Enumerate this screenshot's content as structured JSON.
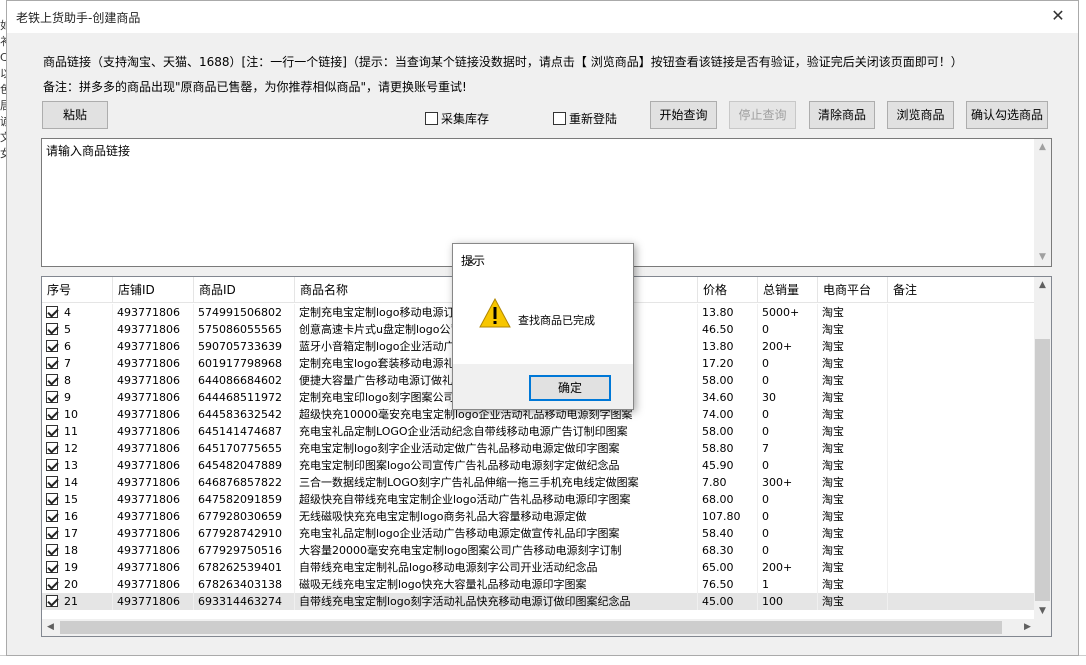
{
  "background_app": {
    "left_chars": [
      "如",
      "衤",
      "Ct",
      "以",
      "色",
      "居",
      "谚",
      "文",
      "女"
    ]
  },
  "window": {
    "title": "老铁上货助手-创建商品",
    "close_glyph": "✕"
  },
  "notes": {
    "line1": "商品链接（支持淘宝、天猫、1688）[注：一行一个链接]（提示：当查询某个链接没数据时，请点击【 浏览商品】按钮查看该链接是否有验证，验证完后关闭该页面即可！）",
    "line2": "备注：拼多多的商品出现\"原商品已售罄，为你推荐相似商品\"，请更换账号重试!"
  },
  "toolbar": {
    "paste": "粘贴",
    "collect_stock": "采集库存",
    "relogin": "重新登陆",
    "start_query": "开始查询",
    "stop_query": "停止查询",
    "clear": "清除商品",
    "browse": "浏览商品",
    "confirm": "确认勾选商品"
  },
  "link_input": {
    "placeholder": "请输入商品链接"
  },
  "table": {
    "columns": [
      "序号",
      "店铺ID",
      "商品ID",
      "商品名称",
      "价格",
      "总销量",
      "电商平台",
      "备注"
    ],
    "rows": [
      {
        "no": "4",
        "shop": "493771806",
        "id": "574991506802",
        "name": "定制充电宝定制logo移动电源订做广告礼品充电宝刻字定制印字图案",
        "price": "13.80",
        "sales": "5000+",
        "platform": "淘宝",
        "note": ""
      },
      {
        "no": "5",
        "shop": "493771806",
        "id": "575086055565",
        "name": "创意高速卡片式u盘定制logo公司礼品刻字订做广告U盘定制图案",
        "price": "46.50",
        "sales": "0",
        "platform": "淘宝",
        "note": ""
      },
      {
        "no": "6",
        "shop": "493771806",
        "id": "590705733639",
        "name": "蓝牙小音箱定制logo企业活动广告礼品刻字定制图案",
        "price": "13.80",
        "sales": "200+",
        "platform": "淘宝",
        "note": ""
      },
      {
        "no": "7",
        "shop": "493771806",
        "id": "601917798968",
        "name": "定制充电宝logo套装移动电源礼品定制印刷logo",
        "price": "17.20",
        "sales": "0",
        "platform": "淘宝",
        "note": ""
      },
      {
        "no": "8",
        "shop": "493771806",
        "id": "644086684602",
        "name": "便捷大容量广告移动电源订做礼品充电宝定做",
        "price": "58.00",
        "sales": "0",
        "platform": "淘宝",
        "note": ""
      },
      {
        "no": "9",
        "shop": "493771806",
        "id": "644468511972",
        "name": "定制充电宝印logo刻字图案公司礼品定制印户",
        "price": "34.60",
        "sales": "30",
        "platform": "淘宝",
        "note": ""
      },
      {
        "no": "10",
        "shop": "493771806",
        "id": "644583632542",
        "name": "超级快充10000毫安充电宝定制logo企业活动礼品移动电源刻字图案",
        "price": "74.00",
        "sales": "0",
        "platform": "淘宝",
        "note": ""
      },
      {
        "no": "11",
        "shop": "493771806",
        "id": "645141474687",
        "name": "充电宝礼品定制LOGO企业活动纪念自带线移动电源广告订制印图案",
        "price": "58.00",
        "sales": "0",
        "platform": "淘宝",
        "note": ""
      },
      {
        "no": "12",
        "shop": "493771806",
        "id": "645170775655",
        "name": "充电宝定制logo刻字企业活动定做广告礼品移动电源定做印字图案",
        "price": "58.80",
        "sales": "7",
        "platform": "淘宝",
        "note": ""
      },
      {
        "no": "13",
        "shop": "493771806",
        "id": "645482047889",
        "name": "充电宝定制印图案logo公司宣传广告礼品移动电源刻字定做纪念品",
        "price": "45.90",
        "sales": "0",
        "platform": "淘宝",
        "note": ""
      },
      {
        "no": "14",
        "shop": "493771806",
        "id": "646876857822",
        "name": "三合一数据线定制LOGO刻字广告礼品伸缩一拖三手机充电线定做图案",
        "price": "7.80",
        "sales": "300+",
        "platform": "淘宝",
        "note": ""
      },
      {
        "no": "15",
        "shop": "493771806",
        "id": "647582091859",
        "name": "超级快充自带线充电宝定制企业logo活动广告礼品移动电源印字图案",
        "price": "68.00",
        "sales": "0",
        "platform": "淘宝",
        "note": ""
      },
      {
        "no": "16",
        "shop": "493771806",
        "id": "677928030659",
        "name": "无线磁吸快充充电宝定制logo商务礼品大容量移动电源定做",
        "price": "107.80",
        "sales": "0",
        "platform": "淘宝",
        "note": ""
      },
      {
        "no": "17",
        "shop": "493771806",
        "id": "677928742910",
        "name": "充电宝礼品定制logo企业活动广告移动电源定做宣传礼品印字图案",
        "price": "58.40",
        "sales": "0",
        "platform": "淘宝",
        "note": ""
      },
      {
        "no": "18",
        "shop": "493771806",
        "id": "677929750516",
        "name": "大容量20000毫安充电宝定制logo图案公司广告移动电源刻字订制",
        "price": "68.30",
        "sales": "0",
        "platform": "淘宝",
        "note": ""
      },
      {
        "no": "19",
        "shop": "493771806",
        "id": "678262539401",
        "name": "自带线充电宝定制礼品logo移动电源刻字公司开业活动纪念品",
        "price": "65.00",
        "sales": "200+",
        "platform": "淘宝",
        "note": ""
      },
      {
        "no": "20",
        "shop": "493771806",
        "id": "678263403138",
        "name": "磁吸无线充电宝定制logo快充大容量礼品移动电源印字图案",
        "price": "76.50",
        "sales": "1",
        "platform": "淘宝",
        "note": ""
      },
      {
        "no": "21",
        "shop": "493771806",
        "id": "693314463274",
        "name": "自带线充电宝定制logo刻字活动礼品快充移动电源订做印图案纪念品",
        "price": "45.00",
        "sales": "100",
        "platform": "淘宝",
        "note": ""
      }
    ]
  },
  "dialog": {
    "title": "提示",
    "message": "查找商品已完成",
    "ok": "确定",
    "close_glyph": "✕",
    "icon": "warning-icon"
  },
  "colors": {
    "warning_fill": "#f7c600",
    "focus_border": "#0078d7"
  }
}
